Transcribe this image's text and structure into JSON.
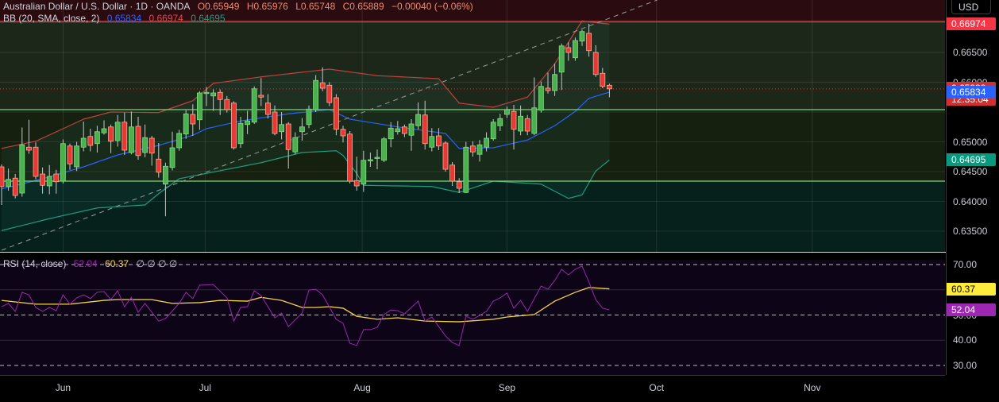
{
  "header": {
    "symbol": "Australian Dollar / U.S. Dollar · 1D · OANDA",
    "open": "O0.65949",
    "high": "H0.65976",
    "low": "L0.65748",
    "close": "C0.65889",
    "change": "−0.00040 (−0.06%)"
  },
  "bb_legend": {
    "label": "BB (20, SMA, close, 2)",
    "basis": "0.65834",
    "upper": "0.66974",
    "lower": "0.64695"
  },
  "rsi_legend": {
    "label": "RSI (14, close)",
    "rsi": "52.04",
    "ma": "60.37",
    "extras": "∅ ∅ ∅ ∅"
  },
  "currency_button": "USD",
  "price_axis": {
    "ticks": [
      {
        "label": "0.66500",
        "value": 0.665
      },
      {
        "label": "0.66000",
        "value": 0.66
      },
      {
        "label": "0.65000",
        "value": 0.65
      },
      {
        "label": "0.64500",
        "value": 0.645
      },
      {
        "label": "0.64000",
        "value": 0.64
      },
      {
        "label": "0.63500",
        "value": 0.635
      }
    ],
    "badges": [
      {
        "label": "0.66974",
        "value": 0.66974,
        "color": "#f23645"
      },
      {
        "label": "0.65889",
        "sub": "12:35:04",
        "value": 0.65889,
        "color": "#d32f2f"
      },
      {
        "label": "0.65834",
        "value": 0.65834,
        "color": "#2962ff"
      },
      {
        "label": "0.64695",
        "value": 0.64695,
        "color": "#089981"
      }
    ]
  },
  "rsi_axis": {
    "ticks": [
      {
        "label": "70.00",
        "value": 70
      },
      {
        "label": "50.00",
        "value": 50
      },
      {
        "label": "40.00",
        "value": 40
      },
      {
        "label": "30.00",
        "value": 30
      }
    ],
    "badges": [
      {
        "label": "60.37",
        "value": 60.37,
        "color": "#ffeb3b",
        "text": "#000"
      },
      {
        "label": "52.04",
        "value": 52.04,
        "color": "#9c27b0",
        "text": "#fff"
      }
    ]
  },
  "time_axis": [
    {
      "label": "Jun",
      "index": 9
    },
    {
      "label": "Jul",
      "index": 29.8
    },
    {
      "label": "Aug",
      "index": 52.8
    },
    {
      "label": "Sep",
      "index": 74
    },
    {
      "label": "Oct",
      "index": 95.9
    },
    {
      "label": "Nov",
      "index": 118.7
    }
  ],
  "colors": {
    "up": "#4caf50",
    "down": "#e53935",
    "up_border": "#7ee07e",
    "down_border": "#ffab91",
    "bb_upper": "#c2403f",
    "bb_basis": "#2962ff",
    "bb_lower": "#1c9e80",
    "rsi": "#9c27b0",
    "rsi_ma": "#f5d547"
  },
  "chart_data": {
    "type": "candlestick",
    "title": "Australian Dollar / U.S. Dollar · 1D · OANDA",
    "ylim": [
      0.6315,
      0.6738
    ],
    "candles_ohlc": [
      [
        0.6458,
        0.6462,
        0.6394,
        0.6425
      ],
      [
        0.6425,
        0.6455,
        0.6418,
        0.6437
      ],
      [
        0.6439,
        0.6446,
        0.6405,
        0.641
      ],
      [
        0.6414,
        0.6524,
        0.6408,
        0.6495
      ],
      [
        0.6491,
        0.6537,
        0.648,
        0.6486
      ],
      [
        0.6491,
        0.6499,
        0.6437,
        0.6442
      ],
      [
        0.6446,
        0.6457,
        0.6413,
        0.6427
      ],
      [
        0.6426,
        0.6461,
        0.6412,
        0.6442
      ],
      [
        0.6446,
        0.6453,
        0.6413,
        0.6433
      ],
      [
        0.6434,
        0.6504,
        0.643,
        0.6497
      ],
      [
        0.6493,
        0.6497,
        0.6453,
        0.6463
      ],
      [
        0.6458,
        0.65,
        0.6451,
        0.6493
      ],
      [
        0.6491,
        0.6534,
        0.6484,
        0.6506
      ],
      [
        0.6509,
        0.6522,
        0.6484,
        0.6494
      ],
      [
        0.6497,
        0.6527,
        0.6482,
        0.6517
      ],
      [
        0.6515,
        0.6536,
        0.6512,
        0.6522
      ],
      [
        0.6525,
        0.6529,
        0.6481,
        0.6501
      ],
      [
        0.6502,
        0.6545,
        0.6492,
        0.6533
      ],
      [
        0.6533,
        0.6549,
        0.6478,
        0.6486
      ],
      [
        0.6482,
        0.6551,
        0.6479,
        0.6525
      ],
      [
        0.6526,
        0.6542,
        0.647,
        0.6477
      ],
      [
        0.6482,
        0.6529,
        0.6474,
        0.6507
      ],
      [
        0.6506,
        0.651,
        0.646,
        0.6481
      ],
      [
        0.6471,
        0.6498,
        0.644,
        0.6449
      ],
      [
        0.6429,
        0.6465,
        0.6375,
        0.6459
      ],
      [
        0.6457,
        0.6517,
        0.6452,
        0.649
      ],
      [
        0.649,
        0.652,
        0.6485,
        0.6514
      ],
      [
        0.6513,
        0.6553,
        0.6505,
        0.6547
      ],
      [
        0.6546,
        0.6563,
        0.651,
        0.653
      ],
      [
        0.6537,
        0.6585,
        0.652,
        0.6582
      ],
      [
        0.6581,
        0.6592,
        0.656,
        0.6583
      ],
      [
        0.6577,
        0.6588,
        0.6552,
        0.6582
      ],
      [
        0.6583,
        0.6588,
        0.6545,
        0.6571
      ],
      [
        0.6571,
        0.6577,
        0.6549,
        0.6554
      ],
      [
        0.6565,
        0.6568,
        0.6487,
        0.649
      ],
      [
        0.6497,
        0.6542,
        0.649,
        0.6531
      ],
      [
        0.6529,
        0.6552,
        0.6513,
        0.6535
      ],
      [
        0.6533,
        0.6593,
        0.653,
        0.6589
      ],
      [
        0.6578,
        0.6607,
        0.656,
        0.6575
      ],
      [
        0.6565,
        0.658,
        0.6539,
        0.6546
      ],
      [
        0.655,
        0.6561,
        0.6511,
        0.6514
      ],
      [
        0.6517,
        0.655,
        0.6504,
        0.6529
      ],
      [
        0.653,
        0.6533,
        0.6455,
        0.6487
      ],
      [
        0.6483,
        0.6516,
        0.6479,
        0.6507
      ],
      [
        0.6517,
        0.654,
        0.6502,
        0.6525
      ],
      [
        0.6529,
        0.6561,
        0.6523,
        0.6555
      ],
      [
        0.6554,
        0.6612,
        0.655,
        0.6603
      ],
      [
        0.6599,
        0.6625,
        0.6585,
        0.659
      ],
      [
        0.6595,
        0.66,
        0.656,
        0.6566
      ],
      [
        0.6574,
        0.658,
        0.6511,
        0.6521
      ],
      [
        0.6521,
        0.6527,
        0.6499,
        0.651
      ],
      [
        0.6513,
        0.6518,
        0.643,
        0.6434
      ],
      [
        0.6435,
        0.6475,
        0.6418,
        0.6426
      ],
      [
        0.6429,
        0.6485,
        0.6416,
        0.6469
      ],
      [
        0.6469,
        0.6482,
        0.6458,
        0.647
      ],
      [
        0.6473,
        0.6487,
        0.6454,
        0.6474
      ],
      [
        0.6469,
        0.6508,
        0.6466,
        0.6505
      ],
      [
        0.6505,
        0.6533,
        0.6491,
        0.6523
      ],
      [
        0.6517,
        0.6535,
        0.6512,
        0.6522
      ],
      [
        0.6525,
        0.6529,
        0.6508,
        0.6514
      ],
      [
        0.6511,
        0.6538,
        0.6485,
        0.653
      ],
      [
        0.6527,
        0.6566,
        0.6521,
        0.6546
      ],
      [
        0.6545,
        0.6569,
        0.6487,
        0.6497
      ],
      [
        0.6491,
        0.6523,
        0.6484,
        0.6509
      ],
      [
        0.651,
        0.6523,
        0.6486,
        0.6493
      ],
      [
        0.6498,
        0.6501,
        0.645,
        0.6454
      ],
      [
        0.6461,
        0.6466,
        0.6426,
        0.6434
      ],
      [
        0.6433,
        0.6439,
        0.6414,
        0.6422
      ],
      [
        0.6415,
        0.65,
        0.6414,
        0.6491
      ],
      [
        0.6493,
        0.6501,
        0.6475,
        0.6483
      ],
      [
        0.6479,
        0.6503,
        0.6467,
        0.6495
      ],
      [
        0.6491,
        0.6516,
        0.6484,
        0.6506
      ],
      [
        0.6505,
        0.6538,
        0.6502,
        0.6533
      ],
      [
        0.6527,
        0.6547,
        0.6518,
        0.6539
      ],
      [
        0.6546,
        0.6559,
        0.654,
        0.6554
      ],
      [
        0.6551,
        0.6562,
        0.6487,
        0.6521
      ],
      [
        0.6518,
        0.6561,
        0.6511,
        0.6543
      ],
      [
        0.6539,
        0.6545,
        0.6511,
        0.6518
      ],
      [
        0.6514,
        0.6608,
        0.6511,
        0.6557
      ],
      [
        0.6553,
        0.6601,
        0.6549,
        0.6593
      ],
      [
        0.659,
        0.6616,
        0.6581,
        0.6586
      ],
      [
        0.6586,
        0.6631,
        0.6577,
        0.6613
      ],
      [
        0.6617,
        0.6665,
        0.6587,
        0.6661
      ],
      [
        0.6658,
        0.6667,
        0.6636,
        0.665
      ],
      [
        0.6641,
        0.6675,
        0.6636,
        0.667
      ],
      [
        0.6669,
        0.6688,
        0.6661,
        0.6685
      ],
      [
        0.6682,
        0.6698,
        0.6643,
        0.6653
      ],
      [
        0.665,
        0.6662,
        0.6609,
        0.6613
      ],
      [
        0.6615,
        0.6624,
        0.659,
        0.6593
      ],
      [
        0.65949,
        0.65976,
        0.65748,
        0.65889
      ]
    ],
    "bb_upper": [
      [
        0,
        0.6489
      ],
      [
        5,
        0.6501
      ],
      [
        9,
        0.6522
      ],
      [
        12,
        0.6538
      ],
      [
        16,
        0.655
      ],
      [
        23,
        0.6549
      ],
      [
        28,
        0.6569
      ],
      [
        31,
        0.6598
      ],
      [
        38,
        0.6609
      ],
      [
        48,
        0.6622
      ],
      [
        55,
        0.6611
      ],
      [
        64,
        0.6606
      ],
      [
        67,
        0.6565
      ],
      [
        72,
        0.6558
      ],
      [
        77,
        0.6575
      ],
      [
        81,
        0.6631
      ],
      [
        85,
        0.6703
      ],
      [
        89,
        0.66974
      ]
    ],
    "bb_basis": [
      [
        0,
        0.6421
      ],
      [
        6,
        0.6438
      ],
      [
        12,
        0.6458
      ],
      [
        17,
        0.6478
      ],
      [
        23,
        0.6494
      ],
      [
        28,
        0.6511
      ],
      [
        30,
        0.6522
      ],
      [
        35,
        0.6535
      ],
      [
        42,
        0.6547
      ],
      [
        48,
        0.6554
      ],
      [
        51,
        0.6538
      ],
      [
        58,
        0.6525
      ],
      [
        65,
        0.6514
      ],
      [
        67,
        0.6489
      ],
      [
        72,
        0.649
      ],
      [
        77,
        0.6503
      ],
      [
        81,
        0.6527
      ],
      [
        84,
        0.6551
      ],
      [
        86,
        0.6573
      ],
      [
        89,
        0.65834
      ]
    ],
    "bb_lower": [
      [
        0,
        0.6351
      ],
      [
        7,
        0.6371
      ],
      [
        14,
        0.6389
      ],
      [
        21,
        0.6394
      ],
      [
        23,
        0.6413
      ],
      [
        26,
        0.6438
      ],
      [
        30,
        0.6447
      ],
      [
        38,
        0.6465
      ],
      [
        44,
        0.6482
      ],
      [
        49,
        0.6485
      ],
      [
        50,
        0.6477
      ],
      [
        52,
        0.6447
      ],
      [
        53,
        0.6427
      ],
      [
        63,
        0.6425
      ],
      [
        67,
        0.6415
      ],
      [
        72,
        0.6434
      ],
      [
        79,
        0.6429
      ],
      [
        83,
        0.6405
      ],
      [
        85,
        0.6411
      ],
      [
        87,
        0.6451
      ],
      [
        89,
        0.64695
      ]
    ],
    "horizontal_lines": [
      {
        "value": 0.6702,
        "color": "#e0484e"
      },
      {
        "value": 0.6554,
        "color": "#7bd67b"
      },
      {
        "value": 0.6434,
        "color": "#7bd67b"
      }
    ],
    "last_price_line": 0.65889,
    "trend_line": [
      [
        0,
        0.6318
      ],
      [
        96,
        0.6738
      ]
    ],
    "rsi": {
      "ylim": [
        25,
        75
      ],
      "levels": [
        70,
        50,
        30
      ],
      "grid": [
        60,
        40
      ],
      "values": [
        [
          0,
          53.3
        ],
        [
          1,
          54.6
        ],
        [
          2,
          51.4
        ],
        [
          3,
          59
        ],
        [
          4,
          58
        ],
        [
          5,
          53
        ],
        [
          6,
          51.4
        ],
        [
          7,
          53
        ],
        [
          8,
          51.7
        ],
        [
          9,
          58
        ],
        [
          10,
          54.3
        ],
        [
          11,
          56.8
        ],
        [
          12,
          58
        ],
        [
          13,
          56.5
        ],
        [
          14,
          59
        ],
        [
          15,
          59.3
        ],
        [
          16,
          56.1
        ],
        [
          17,
          59.6
        ],
        [
          18,
          53.3
        ],
        [
          19,
          57
        ],
        [
          20,
          51.1
        ],
        [
          21,
          54.6
        ],
        [
          23,
          47.6
        ],
        [
          24,
          48.6
        ],
        [
          26,
          54.6
        ],
        [
          27,
          59
        ],
        [
          28,
          56.5
        ],
        [
          29,
          61.8
        ],
        [
          31,
          62.1
        ],
        [
          33,
          56.8
        ],
        [
          34,
          47.6
        ],
        [
          35,
          53
        ],
        [
          36,
          53.3
        ],
        [
          37,
          59.6
        ],
        [
          38,
          57.7
        ],
        [
          40,
          48.9
        ],
        [
          41,
          50.8
        ],
        [
          42,
          45.4
        ],
        [
          44,
          50.8
        ],
        [
          45,
          59.9
        ],
        [
          46,
          60.2
        ],
        [
          47,
          58
        ],
        [
          49,
          48.3
        ],
        [
          50,
          46.7
        ],
        [
          51,
          38.8
        ],
        [
          52,
          37.9
        ],
        [
          53,
          44.2
        ],
        [
          54,
          44.2
        ],
        [
          55,
          45.1
        ],
        [
          56,
          50.2
        ],
        [
          57,
          52
        ],
        [
          58,
          51.7
        ],
        [
          59,
          50.5
        ],
        [
          61,
          55.5
        ],
        [
          62,
          47.6
        ],
        [
          63,
          49.2
        ],
        [
          65,
          41.7
        ],
        [
          66,
          39.1
        ],
        [
          67,
          37.9
        ],
        [
          68,
          49.5
        ],
        [
          69,
          48.3
        ],
        [
          71,
          51.4
        ],
        [
          72,
          55.5
        ],
        [
          73,
          56.8
        ],
        [
          74,
          58.7
        ],
        [
          75,
          52.7
        ],
        [
          76,
          55.8
        ],
        [
          77,
          51.4
        ],
        [
          79,
          61.5
        ],
        [
          80,
          60.2
        ],
        [
          81,
          63.7
        ],
        [
          82,
          68.1
        ],
        [
          83,
          65.9
        ],
        [
          84,
          68.1
        ],
        [
          85,
          69.4
        ],
        [
          86,
          63.1
        ],
        [
          87,
          56.1
        ],
        [
          88,
          52.7
        ],
        [
          89,
          52.04
        ]
      ],
      "ma": [
        [
          0,
          55.8
        ],
        [
          5,
          54.3
        ],
        [
          10,
          54.3
        ],
        [
          15,
          55.8
        ],
        [
          17,
          56.1
        ],
        [
          22,
          56.1
        ],
        [
          25,
          54.6
        ],
        [
          29,
          54.9
        ],
        [
          32,
          55.8
        ],
        [
          36,
          55.5
        ],
        [
          38,
          57
        ],
        [
          41,
          55.8
        ],
        [
          44,
          53
        ],
        [
          46,
          53
        ],
        [
          48,
          53.3
        ],
        [
          50,
          52.7
        ],
        [
          52,
          49.5
        ],
        [
          55,
          48.3
        ],
        [
          58,
          48.9
        ],
        [
          62,
          47.6
        ],
        [
          67,
          47.3
        ],
        [
          72,
          48.3
        ],
        [
          74,
          49.2
        ],
        [
          78,
          50.2
        ],
        [
          81,
          55.5
        ],
        [
          84,
          59
        ],
        [
          86,
          60.9
        ],
        [
          89,
          60.37
        ]
      ]
    }
  }
}
